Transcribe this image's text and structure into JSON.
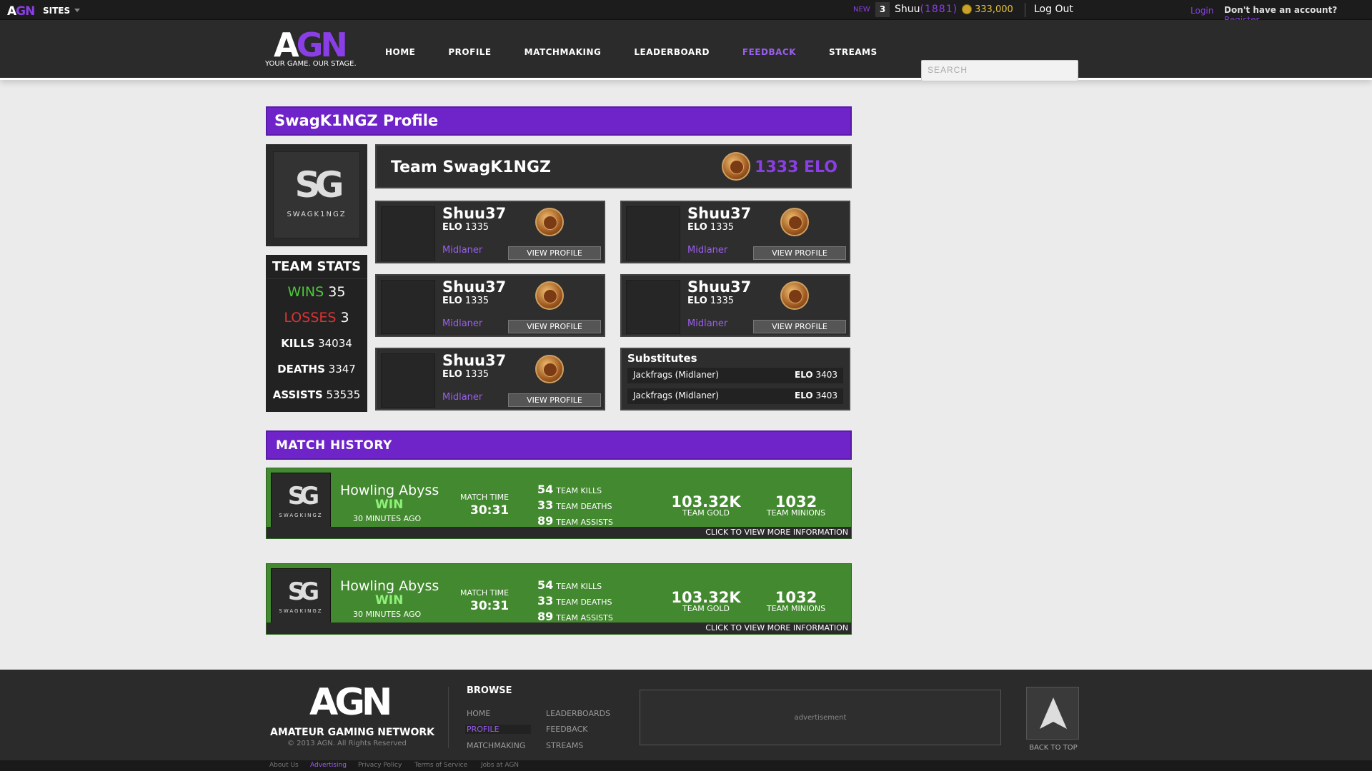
{
  "topbar": {
    "brand_a": "A",
    "brand_gn": "GN",
    "sites": "SITES",
    "new_label": "NEW",
    "notif_count": "3",
    "username": "Shuu",
    "user_elo": "(1881)",
    "coins": "333,000",
    "logout": "Log Out",
    "login": "Login",
    "no_account": "Don't have an account?",
    "register": "Register"
  },
  "header": {
    "logo_a": "A",
    "logo_gn": "GN",
    "tagline": "YOUR GAME. OUR STAGE.",
    "nav": [
      "HOME",
      "PROFILE",
      "MATCHMAKING",
      "LEADERBOARD",
      "FEEDBACK",
      "STREAMS"
    ],
    "active_nav": "FEEDBACK",
    "search_placeholder": "SEARCH"
  },
  "profile": {
    "title": "SwagK1NGZ Profile",
    "logo_text": "SG",
    "logo_sub": "SWAGK1NGZ",
    "team_name": "Team SwagK1NGZ",
    "team_elo": "1333 ELO"
  },
  "team_stats": {
    "title": "TEAM STATS",
    "wins_label": "WINS",
    "wins": "35",
    "losses_label": "LOSSES",
    "losses": "3",
    "kills_label": "KILLS",
    "kills": "34034",
    "deaths_label": "DEATHS",
    "deaths": "3347",
    "assists_label": "ASSISTS",
    "assists": "53535"
  },
  "players": [
    {
      "name": "Shuu37",
      "elo_label": "ELO",
      "elo": "1335",
      "role": "Midlaner",
      "button": "VIEW PROFILE"
    },
    {
      "name": "Shuu37",
      "elo_label": "ELO",
      "elo": "1335",
      "role": "Midlaner",
      "button": "VIEW PROFILE"
    },
    {
      "name": "Shuu37",
      "elo_label": "ELO",
      "elo": "1335",
      "role": "Midlaner",
      "button": "VIEW PROFILE"
    },
    {
      "name": "Shuu37",
      "elo_label": "ELO",
      "elo": "1335",
      "role": "Midlaner",
      "button": "VIEW PROFILE"
    },
    {
      "name": "Shuu37",
      "elo_label": "ELO",
      "elo": "1335",
      "role": "Midlaner",
      "button": "VIEW PROFILE"
    }
  ],
  "substitutes": {
    "title": "Substitutes",
    "items": [
      {
        "name": "Jackfrags (Midlaner)",
        "elo_label": "ELO",
        "elo": "3403"
      },
      {
        "name": "Jackfrags (Midlaner)",
        "elo_label": "ELO",
        "elo": "3403"
      }
    ]
  },
  "match_history": {
    "title": "MATCH HISTORY",
    "matches": [
      {
        "logo_text": "SG",
        "logo_sub": "SWAGKINGZ",
        "map": "Howling Abyss",
        "result": "WIN",
        "ago": "30 MINUTES AGO",
        "time_label": "MATCH TIME",
        "time": "30:31",
        "kills": "54",
        "kills_label": "TEAM KILLS",
        "deaths": "33",
        "deaths_label": "TEAM DEATHS",
        "assists": "89",
        "assists_label": "TEAM ASSISTS",
        "gold": "103.32K",
        "gold_label": "TEAM GOLD",
        "minions": "1032",
        "minions_label": "TEAM MINIONS",
        "footer": "CLICK TO VIEW MORE INFORMATION"
      },
      {
        "logo_text": "SG",
        "logo_sub": "SWAGKINGZ",
        "map": "Howling Abyss",
        "result": "WIN",
        "ago": "30 MINUTES AGO",
        "time_label": "MATCH TIME",
        "time": "30:31",
        "kills": "54",
        "kills_label": "TEAM KILLS",
        "deaths": "33",
        "deaths_label": "TEAM DEATHS",
        "assists": "89",
        "assists_label": "TEAM ASSISTS",
        "gold": "103.32K",
        "gold_label": "TEAM GOLD",
        "minions": "1032",
        "minions_label": "TEAM MINIONS",
        "footer": "CLICK TO VIEW MORE INFORMATION"
      }
    ]
  },
  "footer": {
    "logo": "AGN",
    "name": "AMATEUR GAMING NETWORK",
    "copyright": "© 2013 AGN. All Rights Reserved",
    "browse": "BROWSE",
    "links_col1": [
      "HOME",
      "PROFILE",
      "MATCHMAKING"
    ],
    "links_col2": [
      "LEADERBOARDS",
      "FEEDBACK",
      "STREAMS"
    ],
    "active_link": "PROFILE",
    "ad": "advertisement",
    "back_to_top": "BACK TO TOP",
    "bottom_links": [
      "About Us",
      "Advertising",
      "Privacy Policy",
      "Terms of Service",
      "Jobs at AGN"
    ],
    "bottom_active": "Advertising"
  },
  "colors": {
    "accent": "#8a3ee6",
    "purple_bar": "#6e24c8",
    "win_green": "#43892f",
    "wins_text": "#4cc93a",
    "losses_text": "#dd3333",
    "coin": "#c9a227"
  },
  "icons": [
    "caret-down-icon",
    "coin-icon",
    "rank-badge-icon",
    "back-to-top-arrow-icon",
    "search-icon"
  ]
}
